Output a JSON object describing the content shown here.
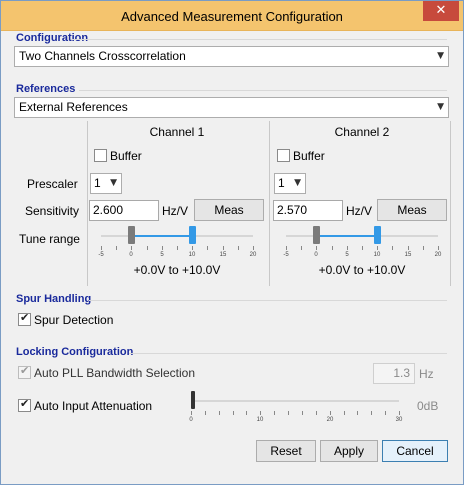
{
  "window": {
    "title": "Advanced Measurement Configuration",
    "close_icon": "✕"
  },
  "configuration": {
    "heading": "Configuration",
    "selected": "Two Channels Crosscorrelation"
  },
  "references": {
    "heading": "References",
    "selected": "External References"
  },
  "channels": {
    "row_labels": {
      "prescaler": "Prescaler",
      "sensitivity": "Sensitivity",
      "tune_range": "Tune range"
    },
    "ch1": {
      "title": "Channel 1",
      "buffer_label": "Buffer",
      "buffer_checked": false,
      "prescaler": "1",
      "sensitivity": "2.600",
      "unit": "Hz/V",
      "meas_label": "Meas",
      "tune_low": -0.0,
      "tune_high": 10.0,
      "range_text": "+0.0V to +10.0V",
      "tick_labels": [
        "-5",
        "0",
        "5",
        "10",
        "15",
        "20"
      ]
    },
    "ch2": {
      "title": "Channel 2",
      "buffer_label": "Buffer",
      "buffer_checked": false,
      "prescaler": "1",
      "sensitivity": "2.570",
      "unit": "Hz/V",
      "meas_label": "Meas",
      "tune_low": 0.0,
      "tune_high": 10.0,
      "range_text": "+0.0V to +10.0V",
      "tick_labels": [
        "-5",
        "0",
        "5",
        "10",
        "15",
        "20"
      ]
    }
  },
  "spur": {
    "heading": "Spur Handling",
    "detection_label": "Spur Detection",
    "detection_checked": true
  },
  "locking": {
    "heading": "Locking Configuration",
    "auto_pll_label": "Auto PLL Bandwidth Selection",
    "auto_pll_checked": true,
    "bandwidth_value": "1.3",
    "bandwidth_unit": "Hz",
    "auto_input_label": "Auto Input Attenuation",
    "auto_input_checked": true,
    "attenuation_text": "0dB",
    "attenuation_value": 0,
    "attenuation_ticks": [
      "0",
      "10",
      "20",
      "30"
    ]
  },
  "buttons": {
    "reset": "Reset",
    "apply": "Apply",
    "cancel": "Cancel"
  },
  "colors": {
    "titlebar": "#f4c46e",
    "close": "#c74a3c",
    "section_heading": "#1a2a9c",
    "slider_range": "#3399e6"
  }
}
